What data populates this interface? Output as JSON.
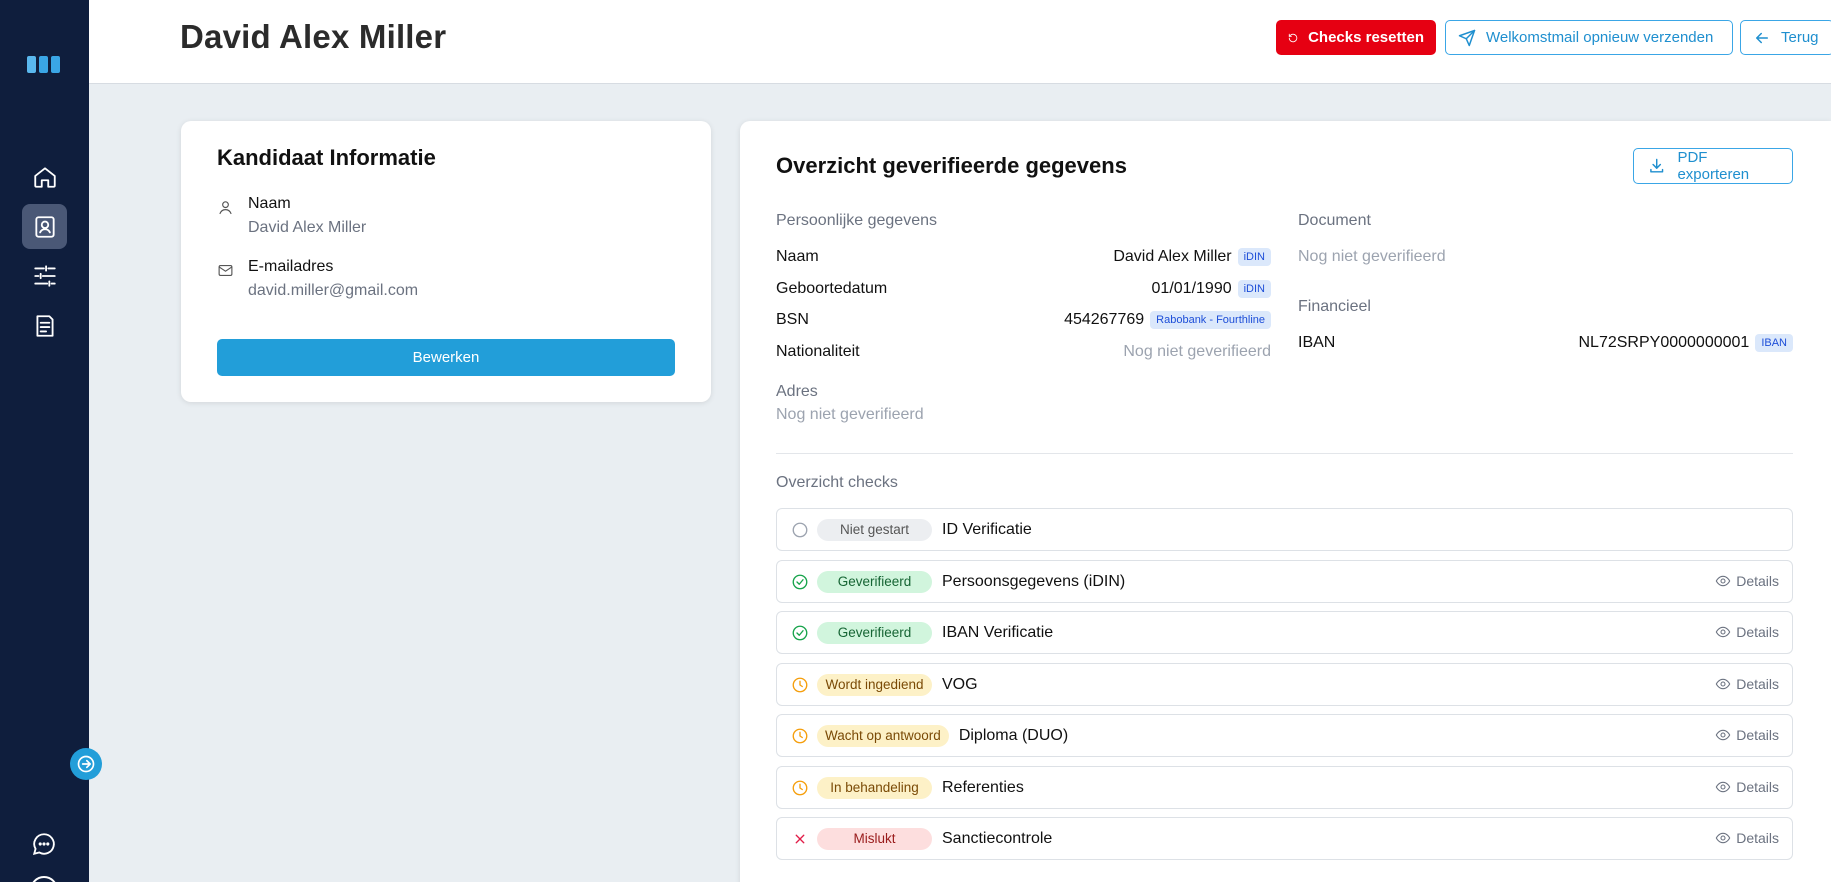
{
  "header": {
    "title": "David Alex Miller",
    "reset_label": "Checks resetten",
    "resend_label": "Welkomstmail opnieuw verzenden",
    "back_label": "Terug"
  },
  "sidebar": {
    "items": [
      {
        "icon": "home-icon"
      },
      {
        "icon": "contact-icon",
        "active": true
      },
      {
        "icon": "sliders-icon"
      },
      {
        "icon": "document-icon"
      }
    ]
  },
  "candidate": {
    "title": "Kandidaat Informatie",
    "name_label": "Naam",
    "name_value": "David Alex Miller",
    "email_label": "E-mailadres",
    "email_value": "david.miller@gmail.com",
    "edit_label": "Bewerken"
  },
  "overview": {
    "title": "Overzicht geverifieerde gegevens",
    "pdf_label": "PDF exporteren",
    "personal": {
      "label": "Persoonlijke gegevens",
      "rows": [
        {
          "key": "Naam",
          "value": "David Alex Miller",
          "tag": "iDIN"
        },
        {
          "key": "Geboortedatum",
          "value": "01/01/1990",
          "tag": "iDIN"
        },
        {
          "key": "BSN",
          "value": "454267769",
          "tag": "Rabobank - Fourthline"
        },
        {
          "key": "Nationaliteit",
          "value": "Nog niet geverifieerd",
          "tag": ""
        }
      ]
    },
    "address": {
      "label": "Adres",
      "value": "Nog niet geverifieerd"
    },
    "document": {
      "label": "Document",
      "value": "Nog niet geverifieerd"
    },
    "financial": {
      "label": "Financieel",
      "iban_key": "IBAN",
      "iban_value": "NL72SRPY0000000001",
      "iban_tag": "IBAN"
    },
    "checks_label": "Overzicht checks",
    "details_label": "Details",
    "checks": [
      {
        "status": "Niet gestart",
        "name": "ID Verificatie"
      },
      {
        "status": "Geverifieerd",
        "name": "Persoonsgegevens (iDIN)"
      },
      {
        "status": "Geverifieerd",
        "name": "IBAN Verificatie"
      },
      {
        "status": "Wordt ingediend",
        "name": "VOG"
      },
      {
        "status": "Wacht op antwoord",
        "name": "Diploma (DUO)"
      },
      {
        "status": "In behandeling",
        "name": "Referenties"
      },
      {
        "status": "Mislukt",
        "name": "Sanctiecontrole"
      }
    ]
  },
  "colors": {
    "sidebar": "#0f1e3d",
    "accent": "#229ed9",
    "danger": "#e60012",
    "success": "#16a34a",
    "warning": "#f59e0b"
  }
}
